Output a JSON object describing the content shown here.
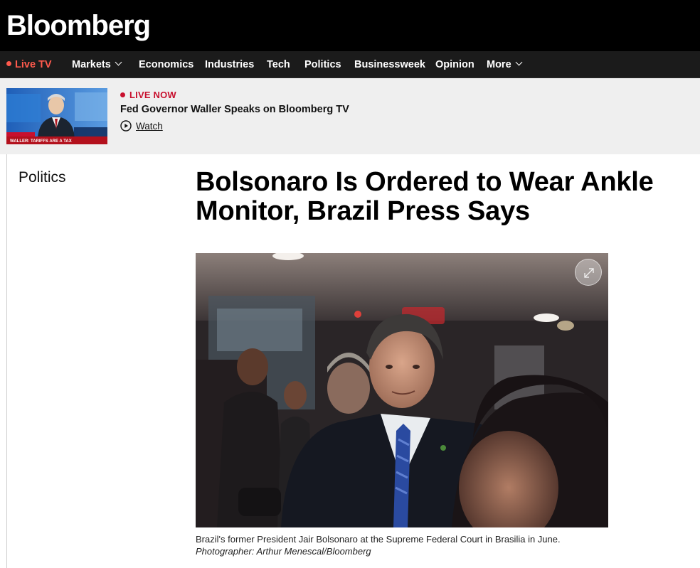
{
  "brand": {
    "logo_text": "Bloomberg"
  },
  "nav": {
    "live_tv": "Live TV",
    "items": [
      {
        "label": "Markets",
        "has_dropdown": true
      },
      {
        "label": "Economics",
        "has_dropdown": false
      },
      {
        "label": "Industries",
        "has_dropdown": false
      },
      {
        "label": "Tech",
        "has_dropdown": false
      },
      {
        "label": "Politics",
        "has_dropdown": false
      },
      {
        "label": "Businessweek",
        "has_dropdown": false
      },
      {
        "label": "Opinion",
        "has_dropdown": false
      },
      {
        "label": "More",
        "has_dropdown": true
      }
    ]
  },
  "live": {
    "badge": "LIVE NOW",
    "title": "Fed Governor Waller Speaks on Bloomberg TV",
    "watch_label": "Watch",
    "thumb_ticker": "WALLER: TARIFFS ARE A TAX"
  },
  "article": {
    "section": "Politics",
    "headline_line1": "Bolsonaro Is Ordered to Wear Ankle",
    "headline_line2": "Monitor, Brazil Press Says",
    "caption_text": "Brazil's former President Jair Bolsonaro at the Supreme Federal Court in Brasilia in June.",
    "caption_credit": "Photographer: Arthur Menescal/Bloomberg"
  },
  "colors": {
    "live_red": "#ff5a4d",
    "badge_red": "#c8102e",
    "topbar": "#000000",
    "navbar": "#1b1b1b",
    "strip": "#efefef"
  }
}
